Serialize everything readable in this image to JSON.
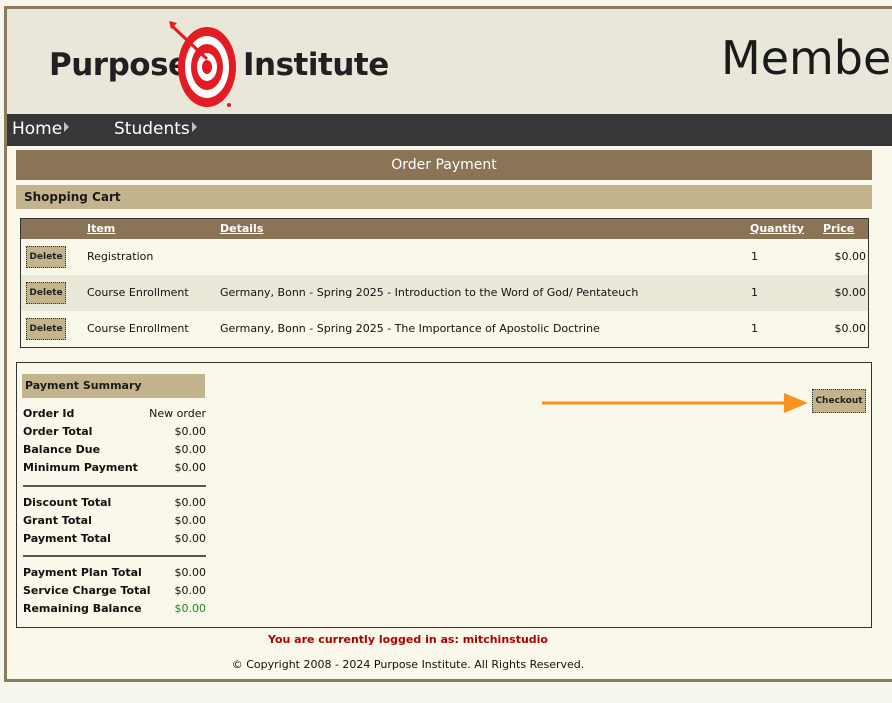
{
  "header": {
    "logo_word_1": "Purpose",
    "logo_word_2": "Institute",
    "title": "Member"
  },
  "nav": {
    "items": [
      {
        "label": "Home"
      },
      {
        "label": "Students"
      }
    ]
  },
  "page": {
    "title": "Order Payment",
    "cart_title": "Shopping Cart"
  },
  "cart": {
    "columns": {
      "item": "Item",
      "details": "Details",
      "quantity": "Quantity",
      "price": "Price"
    },
    "delete_label": "Delete",
    "rows": [
      {
        "item": "Registration",
        "details": "",
        "quantity": "1",
        "price": "$0.00"
      },
      {
        "item": "Course Enrollment",
        "details": "Germany, Bonn - Spring 2025 - Introduction to the Word of God/ Pentateuch",
        "quantity": "1",
        "price": "$0.00"
      },
      {
        "item": "Course Enrollment",
        "details": "Germany, Bonn - Spring 2025 - The Importance of Apostolic Doctrine",
        "quantity": "1",
        "price": "$0.00"
      }
    ]
  },
  "summary": {
    "title": "Payment Summary",
    "checkout_label": "Checkout",
    "group1": [
      {
        "label": "Order Id",
        "value": "New order"
      },
      {
        "label": "Order Total",
        "value": "$0.00"
      },
      {
        "label": "Balance Due",
        "value": "$0.00"
      },
      {
        "label": "Minimum Payment",
        "value": "$0.00"
      }
    ],
    "group2": [
      {
        "label": "Discount Total",
        "value": "$0.00"
      },
      {
        "label": "Grant Total",
        "value": "$0.00"
      },
      {
        "label": "Payment Total",
        "value": "$0.00"
      }
    ],
    "group3": [
      {
        "label": "Payment Plan Total",
        "value": "$0.00"
      },
      {
        "label": "Service Charge Total",
        "value": "$0.00"
      },
      {
        "label": "Remaining Balance",
        "value": "$0.00"
      }
    ]
  },
  "footer": {
    "logged_in": "You are currently logged in as: mitchinstudio",
    "copyright": "© Copyright 2008 - 2024 Purpose Institute. All Rights Reserved."
  },
  "colors": {
    "header_bg": "#e8e7da",
    "nav_bg": "#373737",
    "title_bar": "#8b7355",
    "section_bar": "#c4b48e",
    "logo_red": "#e31b23",
    "annotation_arrow": "#f7931e",
    "remaining_balance": "#1a8a1a",
    "logged_in_text": "#b00000"
  }
}
